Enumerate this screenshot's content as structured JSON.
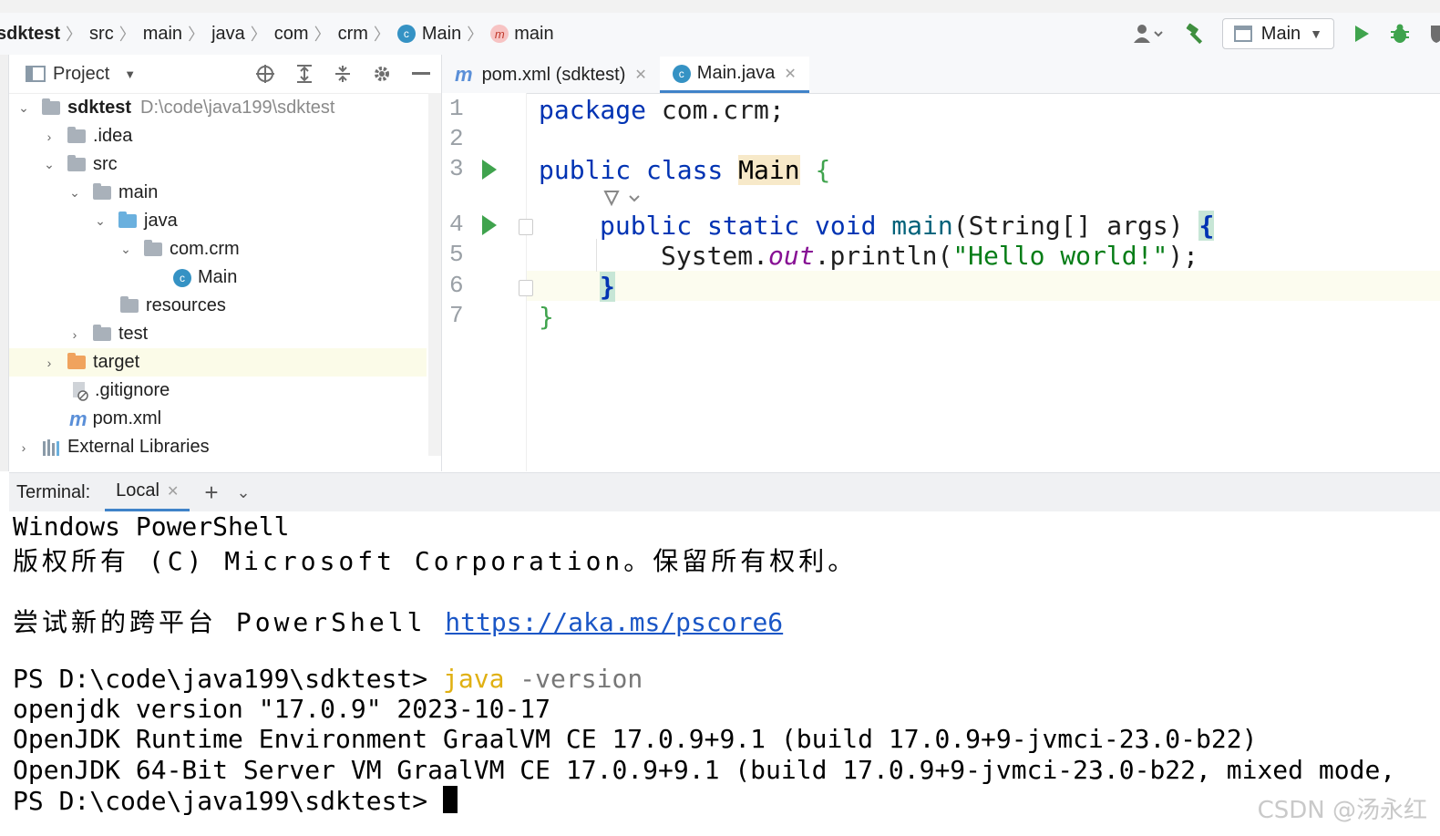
{
  "breadcrumbs": [
    "sdktest",
    "src",
    "main",
    "java",
    "com",
    "crm",
    "Main",
    "main"
  ],
  "toolbar": {
    "run_config": "Main"
  },
  "project": {
    "title": "Project",
    "tree": [
      {
        "label": "sdktest",
        "hint": "D:\\code\\java199\\sdktest"
      },
      {
        "label": ".idea"
      },
      {
        "label": "src"
      },
      {
        "label": "main"
      },
      {
        "label": "java"
      },
      {
        "label": "com.crm"
      },
      {
        "label": "Main"
      },
      {
        "label": "resources"
      },
      {
        "label": "test"
      },
      {
        "label": "target"
      },
      {
        "label": ".gitignore"
      },
      {
        "label": "pom.xml"
      },
      {
        "label": "External Libraries"
      }
    ]
  },
  "editor": {
    "tabs": [
      {
        "label": "pom.xml (sdktest)"
      },
      {
        "label": "Main.java"
      }
    ],
    "line_numbers": [
      "1",
      "2",
      "3",
      "4",
      "5",
      "6",
      "7"
    ],
    "code": {
      "l1_kw": "package",
      "l1_rest": " com.crm;",
      "l3_kw": "public class ",
      "l3_cls": "Main",
      "l3_rest": " {",
      "l4_kw": "public static void ",
      "l4_m": "main",
      "l4_rest": "(String[] args) ",
      "l4_brace": "{",
      "l5_a": "System.",
      "l5_fld": "out",
      "l5_b": ".println(",
      "l5_str": "\"Hello world!\"",
      "l5_c": ");",
      "l6_brace": "}",
      "l7": "}"
    }
  },
  "terminal": {
    "label": "Terminal:",
    "tab": "Local",
    "lines": {
      "l1": "Windows PowerShell",
      "l2": "版权所有 (C) Microsoft Corporation。保留所有权利。",
      "l3_text": "尝试新的跨平台 PowerShell ",
      "l3_link": "https://aka.ms/pscore6",
      "l4_prompt": "PS D:\\code\\java199\\sdktest> ",
      "l4_cmd": "java",
      "l4_arg": " -version",
      "l5": "openjdk version \"17.0.9\" 2023-10-17",
      "l6": "OpenJDK Runtime Environment GraalVM CE 17.0.9+9.1 (build 17.0.9+9-jvmci-23.0-b22)",
      "l7": "OpenJDK 64-Bit Server VM GraalVM CE 17.0.9+9.1 (build 17.0.9+9-jvmci-23.0-b22, mixed mode,",
      "l8_prompt": "PS D:\\code\\java199\\sdktest> "
    }
  },
  "watermark": "CSDN @汤永红"
}
